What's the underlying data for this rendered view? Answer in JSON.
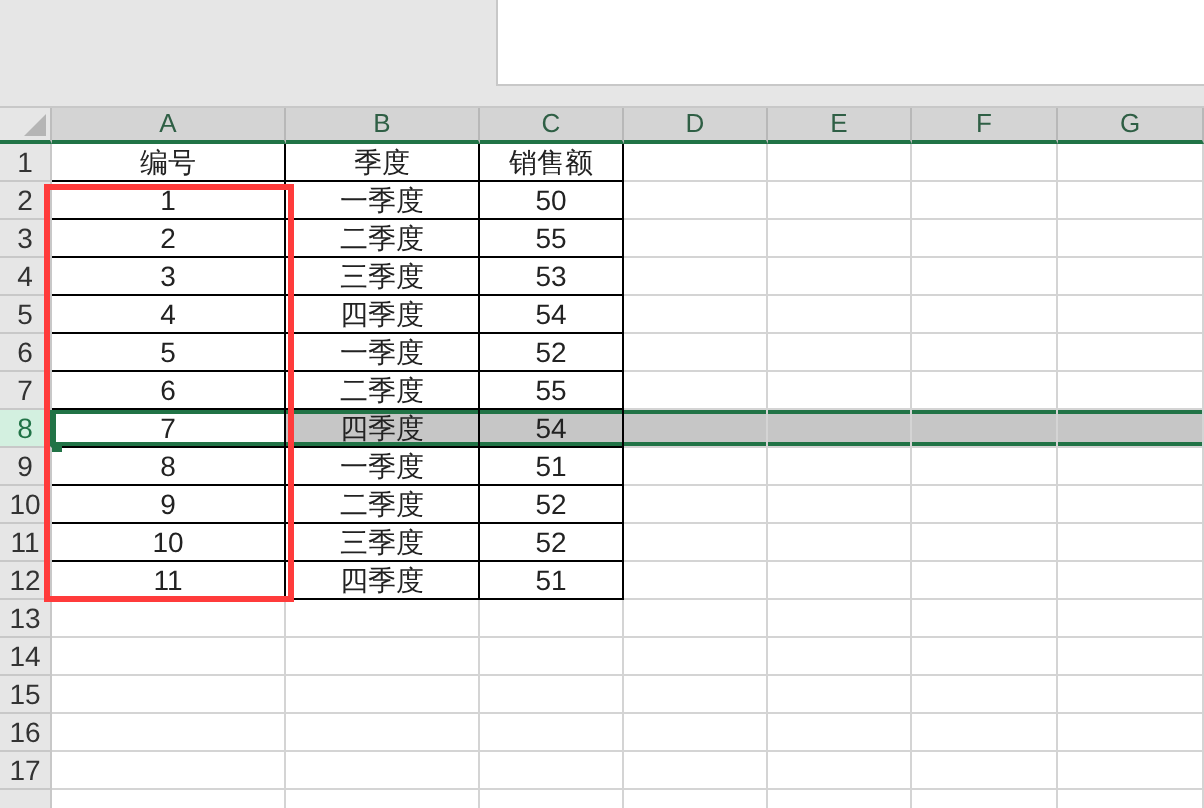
{
  "columns": [
    "A",
    "B",
    "C",
    "D",
    "E",
    "F",
    "G"
  ],
  "rows": [
    {
      "label": "1",
      "selected": false,
      "cells": [
        "编号",
        "季度",
        "销售额"
      ]
    },
    {
      "label": "2",
      "selected": false,
      "cells": [
        "1",
        "一季度",
        "50"
      ]
    },
    {
      "label": "3",
      "selected": false,
      "cells": [
        "2",
        "二季度",
        "55"
      ]
    },
    {
      "label": "4",
      "selected": false,
      "cells": [
        "3",
        "三季度",
        "53"
      ]
    },
    {
      "label": "5",
      "selected": false,
      "cells": [
        "4",
        "四季度",
        "54"
      ]
    },
    {
      "label": "6",
      "selected": false,
      "cells": [
        "5",
        "一季度",
        "52"
      ]
    },
    {
      "label": "7",
      "selected": false,
      "cells": [
        "6",
        "二季度",
        "55"
      ]
    },
    {
      "label": "8",
      "selected": true,
      "cells": [
        "7",
        "四季度",
        "54"
      ]
    },
    {
      "label": "9",
      "selected": false,
      "cells": [
        "8",
        "一季度",
        "51"
      ]
    },
    {
      "label": "10",
      "selected": false,
      "cells": [
        "9",
        "二季度",
        "52"
      ]
    },
    {
      "label": "11",
      "selected": false,
      "cells": [
        "10",
        "三季度",
        "52"
      ]
    },
    {
      "label": "12",
      "selected": false,
      "cells": [
        "11",
        "四季度",
        "51"
      ]
    },
    {
      "label": "13",
      "selected": false
    },
    {
      "label": "14",
      "selected": false
    },
    {
      "label": "15",
      "selected": false
    },
    {
      "label": "16",
      "selected": false
    },
    {
      "label": "17",
      "selected": false
    }
  ]
}
